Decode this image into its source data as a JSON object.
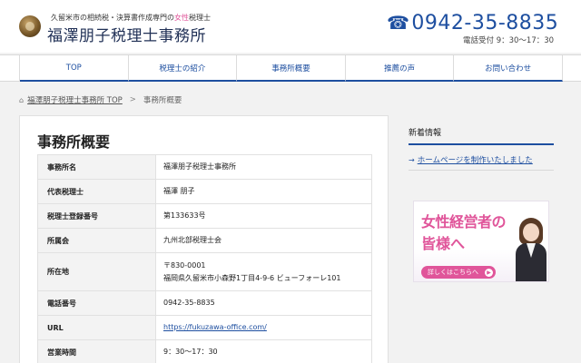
{
  "header": {
    "tagline_prefix": "久留米市の相続税・決算書作成専門の",
    "tagline_highlight": "女性",
    "tagline_suffix": "税理士",
    "site_title": "福澤朋子税理士事務所",
    "phone": "0942-35-8835",
    "hours": "電話受付 9：30～17：30"
  },
  "nav": {
    "items": [
      "TOP",
      "税理士の紹介",
      "事務所概要",
      "推薦の声",
      "お問い合わせ"
    ]
  },
  "breadcrumb": {
    "home": "福澤朋子税理士事務所 TOP",
    "separator": ">",
    "current": "事務所概要"
  },
  "main": {
    "title": "事務所概要",
    "rows": [
      {
        "label": "事務所名",
        "value": "福澤朋子税理士事務所"
      },
      {
        "label": "代表税理士",
        "value": "福澤 朋子"
      },
      {
        "label": "税理士登録番号",
        "value": "第133633号"
      },
      {
        "label": "所属会",
        "value": "九州北部税理士会"
      },
      {
        "label": "所在地",
        "value_line1": "〒830-0001",
        "value_line2": "福岡県久留米市小森野1丁目4-9-6 ビューフォーレ101"
      },
      {
        "label": "電話番号",
        "value": "0942-35-8835"
      },
      {
        "label": "URL",
        "value": "https://fukuzawa-office.com/"
      },
      {
        "label": "営業時間",
        "value": "9：30～17：30"
      }
    ]
  },
  "sidebar": {
    "heading": "新着情報",
    "news": [
      "ホームページを制作いたしました"
    ]
  },
  "banner": {
    "line1": "女性経営者の",
    "line2": "皆様へ",
    "button_label": "詳しくはこちらへ"
  },
  "colors": {
    "accent_blue": "#1e4fa0",
    "accent_pink": "#e0559a",
    "title_navy": "#1f2f55"
  }
}
